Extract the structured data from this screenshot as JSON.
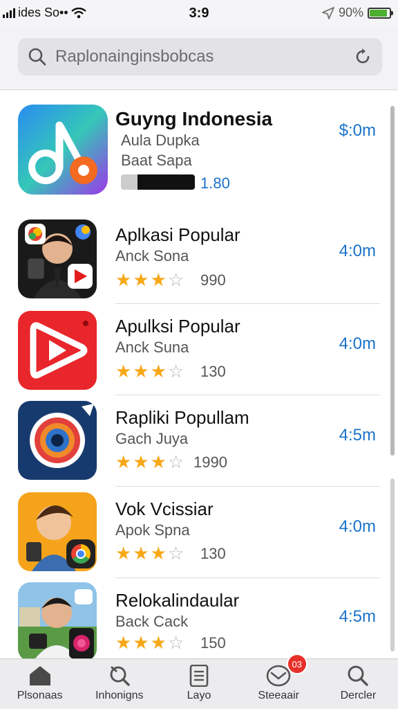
{
  "status": {
    "carrier": "ides So••",
    "time": "3:9",
    "battery": "90%",
    "battery_level": 0.9
  },
  "search": {
    "placeholder": "Raplonainginsbobcas"
  },
  "apps": [
    {
      "title": "Guyng Indonesia",
      "sub1": "Aula Dupka",
      "sub2": "Baat Sapa",
      "progress_value": "1.80",
      "size": "$:0m",
      "icon": "music-note-icon"
    },
    {
      "title": "Aplkasi Popular",
      "sub1": "Anck Sona",
      "rating": 3,
      "count": "990",
      "size": "4:0m",
      "icon": "person-video-icon"
    },
    {
      "title": "Apulksi Popular",
      "sub1": "Anck Suna",
      "rating": 3,
      "count": "130",
      "size": "4:0m",
      "icon": "play-button-icon"
    },
    {
      "title": "Rapliki Popullam",
      "sub1": "Gach Juya",
      "rating": 3,
      "count": "1990",
      "size": "4:5m",
      "icon": "camera-lens-icon"
    },
    {
      "title": "Vok Vcissiar",
      "sub1": "Apok Spna",
      "rating": 3,
      "count": "130",
      "size": "4:0m",
      "icon": "cartoon-person-icon"
    },
    {
      "title": "Relokalindaular",
      "sub1": "Back Cack",
      "rating": 3,
      "count": "150",
      "size": "4:5m",
      "icon": "person-photo-icon"
    }
  ],
  "tabs": [
    {
      "label": "Plsonaas",
      "icon": "home-icon"
    },
    {
      "label": "Inhonigns",
      "icon": "search-tool-icon"
    },
    {
      "label": "Layo",
      "icon": "document-icon"
    },
    {
      "label": "Steeaair",
      "icon": "updates-icon",
      "badge": "03"
    },
    {
      "label": "Dercler",
      "icon": "search-icon"
    }
  ],
  "colors": {
    "accent": "#1a73c9",
    "star": "#f7a818",
    "badge": "#e8302a"
  }
}
